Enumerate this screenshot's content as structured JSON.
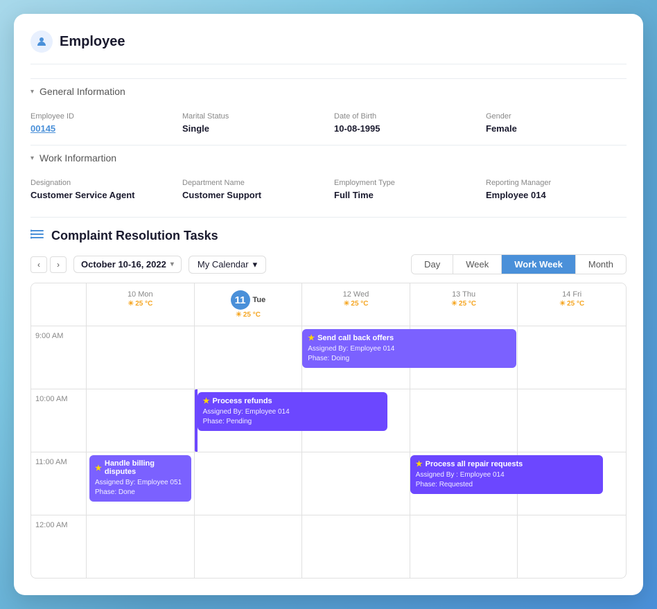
{
  "page": {
    "title": "Employee",
    "user_icon": "👤"
  },
  "general_info": {
    "section_label": "General Information",
    "fields": [
      {
        "label": "Employee ID",
        "value": "00145",
        "is_link": true
      },
      {
        "label": "Marital Status",
        "value": "Single"
      },
      {
        "label": "Date of Birth",
        "value": "10-08-1995"
      },
      {
        "label": "Gender",
        "value": "Female"
      }
    ]
  },
  "work_info": {
    "section_label": "Work Informartion",
    "fields": [
      {
        "label": "Designation",
        "value": "Customer Service Agent"
      },
      {
        "label": "Department Name",
        "value": "Customer Support"
      },
      {
        "label": "Employment Type",
        "value": "Full Time"
      },
      {
        "label": "Reporting Manager",
        "value": "Employee 014"
      }
    ]
  },
  "complaint": {
    "title": "Complaint Resolution Tasks"
  },
  "calendar": {
    "date_range": "October 10-16, 2022",
    "calendar_selector": "My Calendar",
    "views": [
      "Day",
      "Week",
      "Work Week",
      "Month"
    ],
    "active_view": "Work Week",
    "days": [
      {
        "name": "Mon",
        "num": "10",
        "is_today": false,
        "temp": "25 °C"
      },
      {
        "name": "Tue",
        "num": "11",
        "is_today": true,
        "temp": "25 °C"
      },
      {
        "name": "Wed",
        "num": "12",
        "is_today": false,
        "temp": "25 °C"
      },
      {
        "name": "Thu",
        "num": "13",
        "is_today": false,
        "temp": "25 °C"
      },
      {
        "name": "Fri",
        "num": "14",
        "is_today": false,
        "temp": "25 °C"
      }
    ],
    "time_slots": [
      "9:00 AM",
      "10:00 AM",
      "11:00 AM",
      "12:00 AM"
    ],
    "events": {
      "send_call_back": {
        "title": "Send call back offers",
        "assigned": "Assigned By: Employee 014",
        "phase": "Phase: Doing",
        "day_col": 2,
        "time_row": 0,
        "color": "event-purple"
      },
      "process_refunds": {
        "title": "Process refunds",
        "assigned": "Assigned By: Employee 014",
        "phase": "Phase: Pending",
        "day_col": 1,
        "time_row": 1,
        "color": "event-violet"
      },
      "handle_billing": {
        "title": "Handle billing disputes",
        "assigned": "Assigned By: Employee 051",
        "phase": "Phase: Done",
        "day_col": 0,
        "time_row": 2,
        "color": "event-purple"
      },
      "process_repair": {
        "title": "Process all repair requests",
        "assigned": "Assigned By : Employee 014",
        "phase": "Phase: Requested",
        "day_col": 3,
        "time_row": 2,
        "color": "event-violet"
      }
    }
  }
}
